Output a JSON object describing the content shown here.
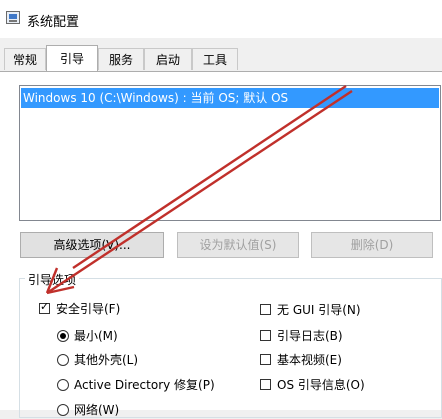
{
  "window": {
    "title": "系统配置"
  },
  "tabs": [
    {
      "label": "常规",
      "active": false
    },
    {
      "label": "引导",
      "active": true
    },
    {
      "label": "服务",
      "active": false
    },
    {
      "label": "启动",
      "active": false
    },
    {
      "label": "工具",
      "active": false
    }
  ],
  "os_list": {
    "items": [
      {
        "label": "Windows 10 (C:\\Windows) : 当前 OS; 默认 OS",
        "selected": true
      }
    ]
  },
  "buttons": {
    "advanced": "高级选项(V)...",
    "set_default": "设为默认值(S)",
    "delete": "删除(D)"
  },
  "boot_options": {
    "label": "引导选项",
    "safe_boot": {
      "label": "安全引导(F)",
      "checked": true
    },
    "minimal": {
      "label": "最小(M)",
      "checked": true
    },
    "alternate_shell": {
      "label": "其他外壳(L)",
      "checked": false
    },
    "ad_repair": {
      "label": "Active Directory 修复(P)",
      "checked": false
    },
    "network": {
      "label": "网络(W)",
      "checked": false
    },
    "no_gui": {
      "label": "无 GUI 引导(N)",
      "checked": false
    },
    "boot_log": {
      "label": "引导日志(B)",
      "checked": false
    },
    "base_video": {
      "label": "基本视频(E)",
      "checked": false
    },
    "os_boot_info": {
      "label": "OS 引导信息(O)",
      "checked": false
    }
  },
  "colors": {
    "selection": "#3399ff",
    "annotation_arrow": "#c0302b"
  },
  "annotation": {
    "icon": "red-arrow-icon"
  }
}
